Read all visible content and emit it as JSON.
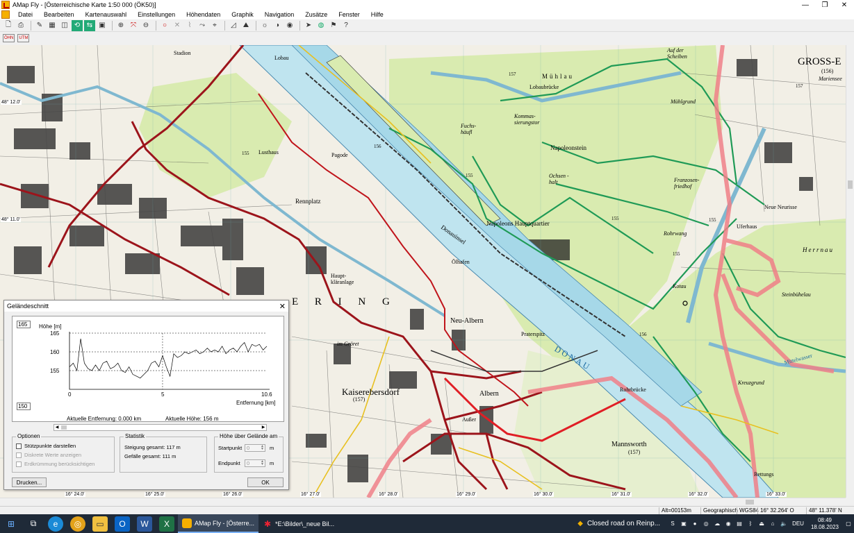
{
  "window": {
    "title": "AMap Fly - [Österreichische Karte 1:50 000 (ÖK50)]",
    "controls": [
      "—",
      "❐",
      "✕"
    ]
  },
  "menu": [
    "Datei",
    "Bearbeiten",
    "Kartenauswahl",
    "Einstellungen",
    "Höhendaten",
    "Graphik",
    "Navigation",
    "Zusätze",
    "Fenster",
    "Hilfe"
  ],
  "toolbar2_labels": [
    "ÖHN",
    "UTM"
  ],
  "map": {
    "lat_labels": [
      "48° 12.0'",
      "48° 11.0'"
    ],
    "lon_labels": [
      "16° 24.0'",
      "16° 25.0'",
      "16° 26.0'",
      "16° 27.0'",
      "16° 28.0'",
      "16° 29.0'",
      "16° 30.0'",
      "16° 31.0'",
      "16° 32.0'",
      "16° 33.0'"
    ],
    "place_names": {
      "gross_enzersdorf": "GROSS-E",
      "stadion": "Stadion",
      "lobau": "Lobau",
      "muehlau": "Mühlau",
      "lobaubruecke": "Lobaubrücke",
      "napoleonstein": "Napoleonstein",
      "rennplatz": "Rennplatz",
      "pagode": "Pagode",
      "donauinsel": "Donauinsel",
      "neu_albern": "Neu-Albern",
      "praterspitz": "Praterspitz",
      "donau": "DONAU",
      "kaiserebersdorf": "Kaiserebersdorf",
      "albern": "Albern",
      "mannsworth": "Mannsworth",
      "rohrwang": "Rohrwang",
      "neue_neurisse": "Neue Neurisse",
      "franzosenfriedhof": "Franzosen-friedhof",
      "steinbuehelau": "Steinbühelau",
      "kreuzgrund": "Kreuzgrund",
      "rohrbruecke": "Rohrbrücke",
      "lusthaus": "Lusthaus",
      "oelhafen": "Ölhafen",
      "kloeranlage": "Haupt-kläranlage",
      "im_groeret": "im Gröret",
      "rettungs": "Rettungs",
      "mittelwasser": "Mittelwasser",
      "ochsen_halt": "Ochsen -halt",
      "kommas": "Kommas-sierungstor",
      "napoleons_hq": "Napoleons Hauptquartier",
      "uferhaus": "Uferhaus",
      "muehlgrund": "Mühlgrund",
      "herrnau": "Herrnau",
      "ering": "E R I N G",
      "fuchs": "Fuchs-häufl",
      "kotau": "Kotau",
      "auf_der_scheiben": "Auf der Scheiben",
      "marienseer": "Mariensee",
      "ausser": "Außer",
      "ring_156": "(156)",
      "k157": "(157)",
      "k157b": "(157)"
    },
    "elevations": [
      "157",
      "155",
      "157",
      "156",
      "155",
      "155",
      "156",
      "155",
      "155"
    ]
  },
  "dialog": {
    "title": "Geländeschnitt",
    "close": "✕",
    "hmax_box": "165",
    "hmin_box": "150",
    "y_axis_title": "Höhe [m]",
    "x_axis_title": "Entfernung [km]",
    "current_distance": "Aktuelle Entfernung: 0.000 km",
    "current_height": "Aktuelle Höhe: 156 m",
    "options_title": "Optionen",
    "option_support_points": "Stützpunkte darstellen",
    "option_discrete": "Diskrete Werte anzeigen",
    "option_curvature": "Erdkrümmung berücksichtigen",
    "stats_title": "Statistik",
    "ascent": "Steigung gesamt: 117 m",
    "descent": "Gefälle gesamt: 111 m",
    "height_title": "Höhe über Gelände am",
    "start_label": "Startpunkt",
    "end_label": "Endpunkt",
    "start_value": "0",
    "end_value": "0",
    "unit_m": "m",
    "print_button": "Drucken...",
    "ok_button": "OK"
  },
  "chart_data": {
    "type": "line",
    "title": "",
    "xlabel": "Entfernung [km]",
    "ylabel": "Höhe [m]",
    "xlim": [
      0,
      10.6
    ],
    "ylim": [
      150,
      165
    ],
    "x_ticks": [
      "0",
      "5",
      "10.6"
    ],
    "y_ticks": [
      "165",
      "160",
      "155"
    ],
    "grid": true,
    "series": [
      {
        "x": [
          0,
          0.2,
          0.4,
          0.6,
          0.8,
          1.0,
          1.2,
          1.4,
          1.6,
          1.8,
          2.0,
          2.2,
          2.4,
          2.6,
          2.8,
          3.0,
          3.2,
          3.4,
          3.6,
          3.8,
          4.0,
          4.2,
          4.4,
          4.6,
          4.8,
          5.0,
          5.2,
          5.4,
          5.6,
          5.8,
          6.0,
          6.2,
          6.4,
          6.6,
          6.8,
          7.0,
          7.2,
          7.4,
          7.6,
          7.8,
          8.0,
          8.2,
          8.4,
          8.6,
          8.8,
          9.0,
          9.2,
          9.4,
          9.6,
          9.8,
          10.0,
          10.2,
          10.4,
          10.6
        ],
        "y": [
          156,
          157,
          155,
          163.5,
          157,
          155.5,
          155,
          156.5,
          155,
          157,
          157.5,
          155.5,
          156,
          157,
          155,
          154.5,
          156,
          154,
          153.5,
          153,
          154,
          155,
          157,
          157.5,
          156,
          159,
          156,
          153.5,
          159.5,
          158.5,
          159,
          160,
          159.5,
          160,
          160.5,
          159.5,
          160,
          161,
          160,
          160.5,
          160,
          161.5,
          159.5,
          160.5,
          161,
          160,
          161.5,
          162.5,
          160,
          162,
          161.5,
          162,
          160.5,
          161.5
        ]
      }
    ]
  },
  "status": {
    "altitude": "Alt=00153m",
    "coord_system": "Geographisch",
    "datum": "WGS84",
    "lon": "16° 32.264' O",
    "lat": "48° 11.378' N"
  },
  "taskbar": {
    "task_amap": "AMap Fly - [Österre...",
    "task_bilder": "*E:\\Bilder\\_neue Bil...",
    "notice": "Closed road on Reinp...",
    "lang": "DEU",
    "time": "08:49",
    "date": "18.08.2023"
  },
  "colors": {
    "water": "#bfe4ef",
    "forest": "#d9ebb0",
    "road_red": "#c0141b",
    "route_pink": "#f08088",
    "trail_green": "#1f9a56",
    "taskbar": "#1f2a38"
  }
}
